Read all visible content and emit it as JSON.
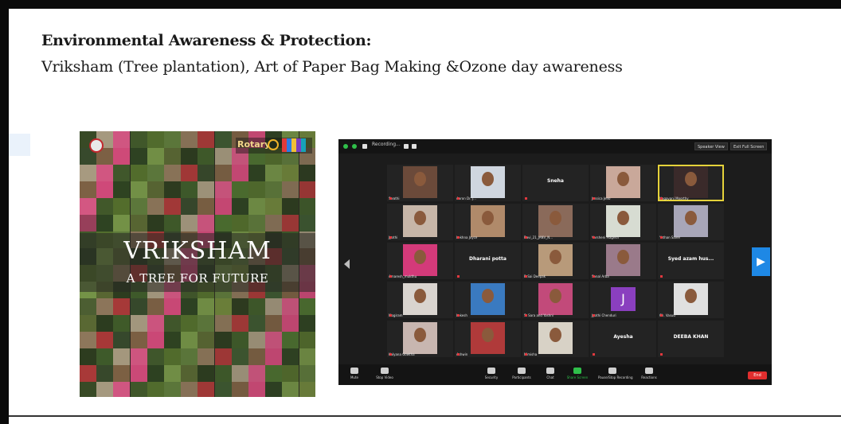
{
  "heading": {
    "title": "Environmental Awareness & Protection:",
    "subtitle": "Vriksham (Tree plantation),  Art of Paper Bag Making &Ozone day awareness"
  },
  "poster": {
    "title": "VRIKSHAM",
    "subtitle": "A TREE FOR FUTURE",
    "rotary_label": "Rotary",
    "tile_colors": [
      "#3f5b2a",
      "#6b7f3a",
      "#2f4a22",
      "#8b6a4a",
      "#b23a3a",
      "#5e7a3c",
      "#4a6b2f",
      "#c8b89a",
      "#2d3f1f",
      "#7a9b4a",
      "#d14a7a",
      "#3c5530",
      "#a88b6a",
      "#5a7a2f",
      "#e05a8a"
    ]
  },
  "zoom": {
    "recording_label": "Recording...",
    "speaker_view": "Speaker View",
    "full_screen": "Exit Full Screen",
    "tiles": [
      {
        "name": "Swathi",
        "type": "video",
        "bg": "#6b4a3a"
      },
      {
        "name": "Aaron Dr. J...",
        "type": "video",
        "bg": "#cfd6df"
      },
      {
        "name": "Sneha",
        "type": "name"
      },
      {
        "name": "Jessica Jeno",
        "type": "video",
        "bg": "#c9a89a"
      },
      {
        "name": "Nagavani Moorthy",
        "type": "video",
        "bg": "#3a2a2a",
        "active": true
      },
      {
        "name": "Jyothi",
        "type": "video",
        "bg": "#c7b6a8"
      },
      {
        "name": "Lekhna Joyce",
        "type": "video",
        "bg": "#b08a6a"
      },
      {
        "name": "Ravi_21_JANV_N...",
        "type": "video",
        "bg": "#8a6a5a"
      },
      {
        "name": "Varsheni Magesh",
        "type": "video",
        "bg": "#d7dcd2"
      },
      {
        "name": "Yuthan Saiee",
        "type": "video",
        "bg": "#a8a6b8"
      },
      {
        "name": "Amaresh_mukthu",
        "type": "video",
        "bg": "#d43a7a"
      },
      {
        "name": "Dharani potta",
        "type": "name"
      },
      {
        "name": "P. Sai Deepak",
        "type": "video",
        "bg": "#b89a7a"
      },
      {
        "name": "Sonal Arba",
        "type": "video",
        "bg": "#9a7a8a"
      },
      {
        "name": "Syed azam hus...",
        "type": "name"
      },
      {
        "name": "Mogiram",
        "type": "video",
        "bg": "#d9d4cf"
      },
      {
        "name": "Lokesh",
        "type": "video",
        "bg": "#3a7ac0"
      },
      {
        "name": "S. Sara and Yashni",
        "type": "video",
        "bg": "#c24a7a"
      },
      {
        "name": "Jyothi Chenduri",
        "type": "avatar",
        "letter": "J"
      },
      {
        "name": "Ch. Vasuu",
        "type": "video",
        "bg": "#e0e0e0"
      },
      {
        "name": "Kalyana Gowtha",
        "type": "video",
        "bg": "#c8b6b0"
      },
      {
        "name": "Ashwin",
        "type": "video",
        "bg": "#b03a3a"
      },
      {
        "name": "Nimisha",
        "type": "video",
        "bg": "#d8d2c6"
      },
      {
        "name": "Ayesha",
        "type": "name"
      },
      {
        "name": "DEEBA KHAN",
        "type": "name"
      }
    ],
    "controls": [
      {
        "label": "Mute",
        "icon": "mic-icon"
      },
      {
        "label": "Stop Video",
        "icon": "video-icon"
      },
      {
        "label": "Security",
        "icon": "shield-icon"
      },
      {
        "label": "Participants",
        "icon": "participants-icon"
      },
      {
        "label": "Chat",
        "icon": "chat-icon"
      },
      {
        "label": "Share Screen",
        "icon": "share-icon"
      },
      {
        "label": "Pause/Stop Recording",
        "icon": "record-icon"
      },
      {
        "label": "Reactions",
        "icon": "reactions-icon"
      }
    ],
    "end_label": "End",
    "accent_color": "#1e88e5",
    "share_color": "#2fbf4a",
    "end_color": "#e02e2e"
  }
}
